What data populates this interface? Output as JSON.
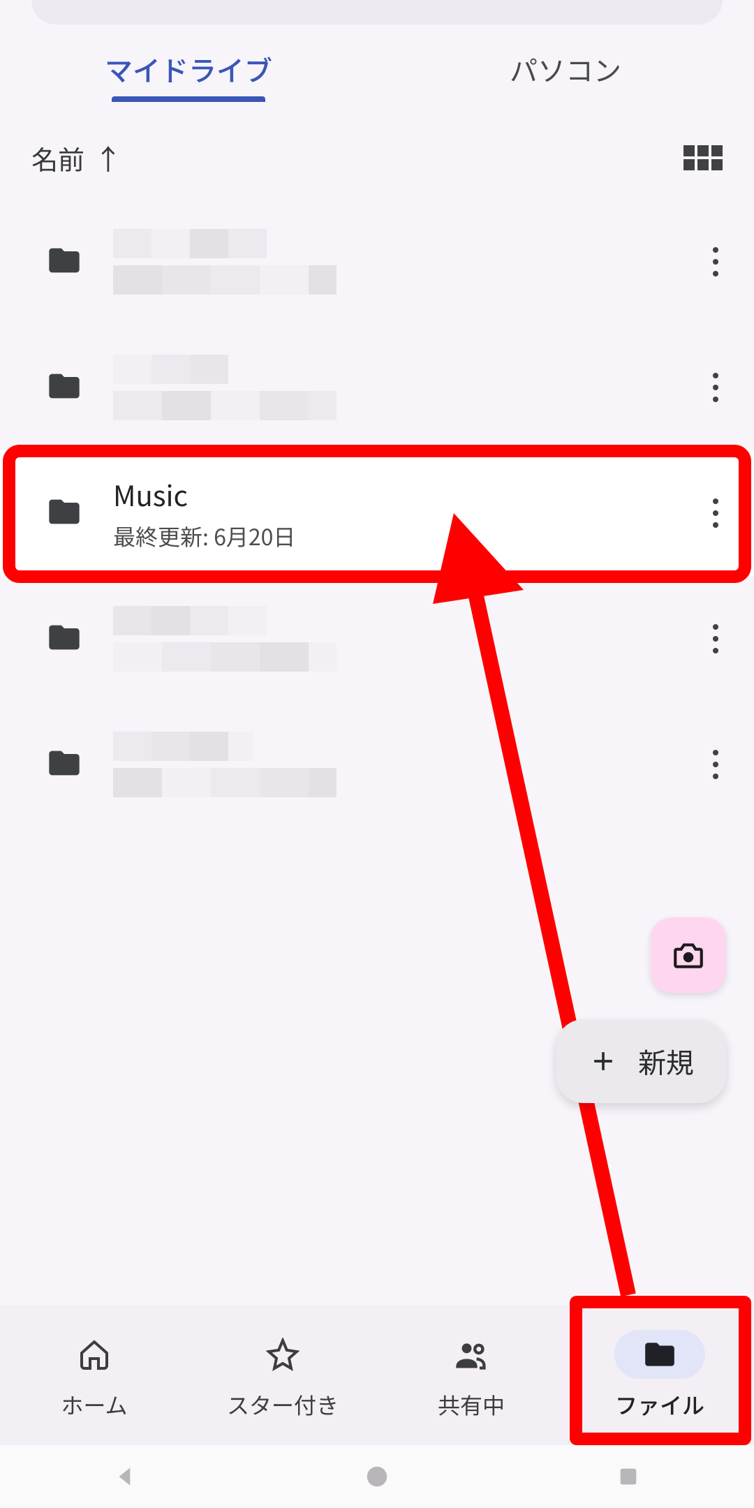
{
  "tabs": {
    "my_drive": "マイドライブ",
    "computers": "パソコン"
  },
  "sort": {
    "label": "名前",
    "direction_icon": "↑"
  },
  "rows": [
    {
      "type": "folder",
      "blurred": true
    },
    {
      "type": "folder",
      "blurred": true
    },
    {
      "type": "folder",
      "blurred": false,
      "title": "Music",
      "subtitle": "最終更新: 6月20日",
      "highlighted": true
    },
    {
      "type": "folder",
      "blurred": true
    },
    {
      "type": "folder",
      "blurred": true
    }
  ],
  "fab": {
    "new_label": "新規"
  },
  "nav": {
    "home": "ホーム",
    "starred": "スター付き",
    "shared": "共有中",
    "files": "ファイル"
  }
}
